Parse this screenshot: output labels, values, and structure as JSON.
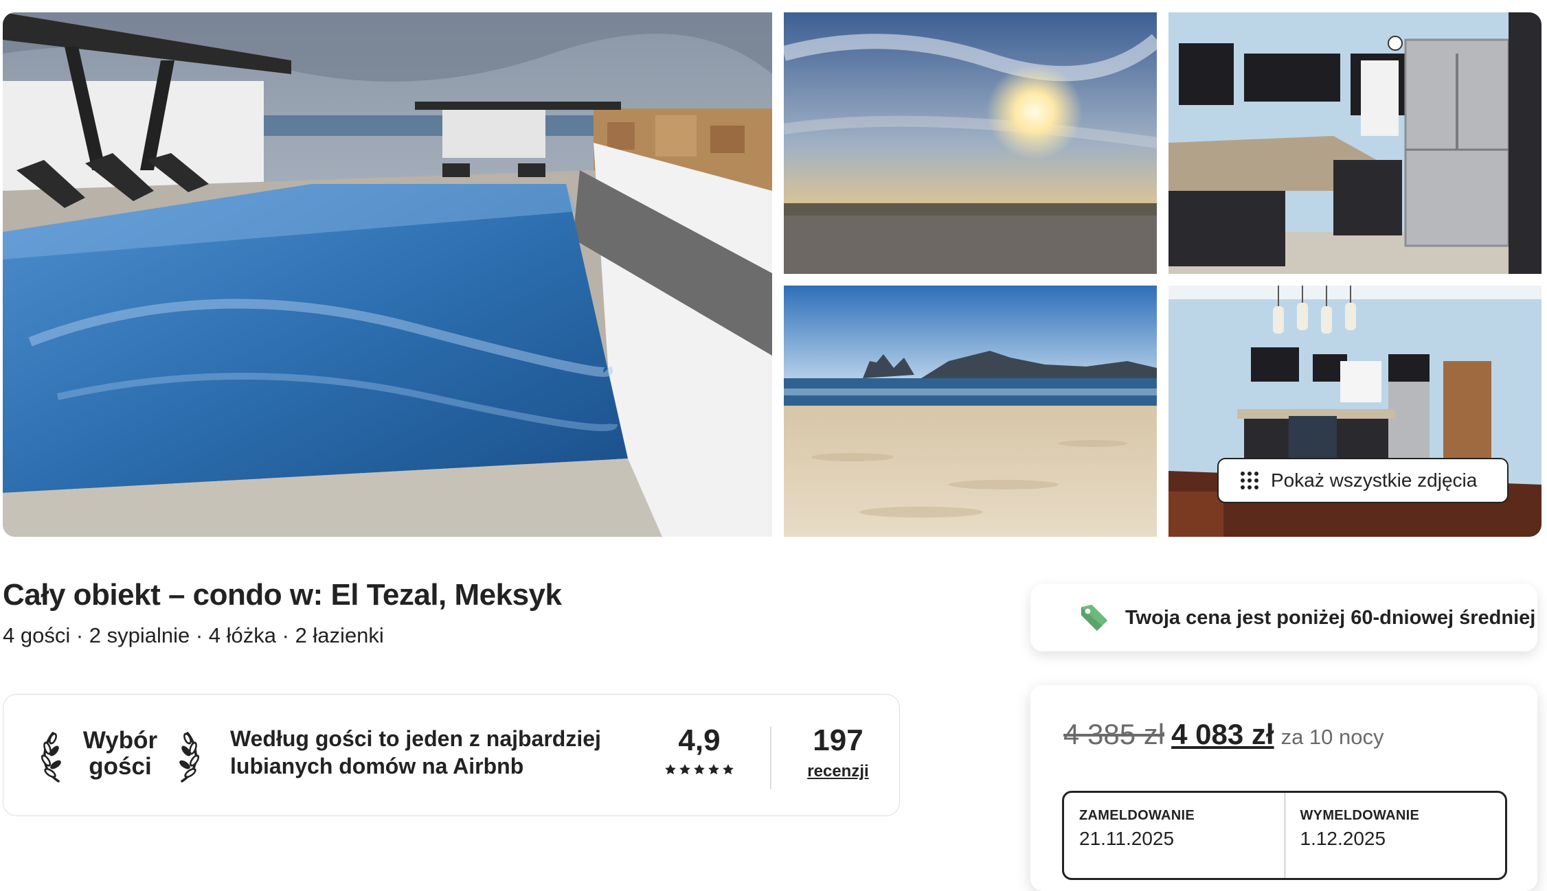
{
  "gallery": {
    "photos": [
      {
        "name": "rooftop-pool",
        "description_icon": "photo-pool"
      },
      {
        "name": "sunset-view",
        "description_icon": "photo-sunset"
      },
      {
        "name": "kitchen",
        "description_icon": "photo-kitchen"
      },
      {
        "name": "beach",
        "description_icon": "photo-beach"
      },
      {
        "name": "kitchen-dining",
        "description_icon": "photo-dining"
      }
    ],
    "show_all_label": "Pokaż wszystkie zdjęcia",
    "show_all_icon": "grid-dots-icon"
  },
  "listing": {
    "title": "Cały obiekt – condo w: El Tezal, Meksyk",
    "subtitle": "4 gości · 2 sypialnie · 4 łóżka · 2 łazienki"
  },
  "guest_favorite": {
    "badge_line1": "Wybór",
    "badge_line2": "gości",
    "description": "Według gości to jeden z najbardziej lubianych domów na Airbnb",
    "rating": "4,9",
    "stars": 5,
    "review_count": "197",
    "review_label": "recenzji"
  },
  "price_notice": {
    "text": "Twoja cena jest poniżej 60-dniowej średniej",
    "icon": "price-tag-icon",
    "icon_color": "#5aa469"
  },
  "booking": {
    "price_old": "4 385 zł",
    "price_new": "4 083 zł",
    "price_suffix": "za 10 nocy",
    "checkin_label": "ZAMELDOWANIE",
    "checkin_value": "21.11.2025",
    "checkout_label": "WYMELDOWANIE",
    "checkout_value": "1.12.2025"
  }
}
